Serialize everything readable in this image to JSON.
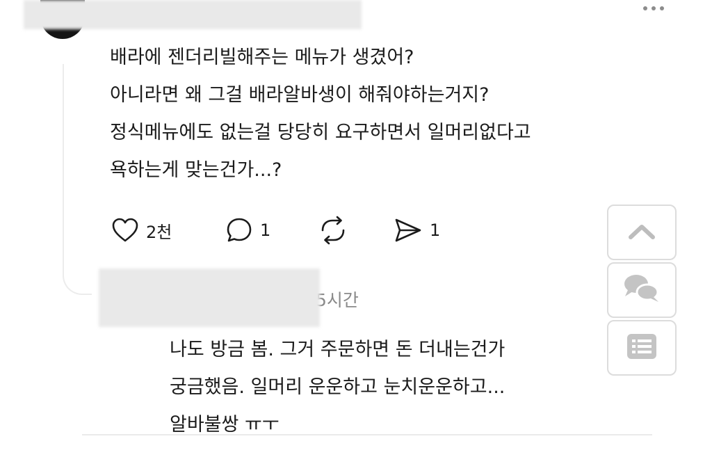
{
  "post": {
    "lines": [
      "배라에 젠더리빌해주는 메뉴가 생겼어?",
      "아니라면 왜 그걸 배라알바생이 해줘야하는거지?",
      "정식메뉴에도 없는걸 당당히 요구하면서 일머리없다고",
      "욕하는게 맞는건가...?"
    ],
    "actions": {
      "like_count": "2천",
      "comment_count": "1",
      "share_count": "1"
    }
  },
  "reply": {
    "time": "5시간",
    "lines": [
      "나도 방금 봄. 그거 주문하면 돈 더내는건가",
      "궁금했음. 일머리 운운하고 눈치운운하고...",
      "알바불쌍 ㅠㅜ"
    ]
  },
  "icons": {
    "more": "more-horizontal-icon",
    "like": "heart-icon",
    "comment": "comment-bubble-icon",
    "repost": "repost-icon",
    "share": "send-icon",
    "scroll_top": "chevron-up-icon",
    "comments": "chat-bubbles-icon",
    "list": "list-icon"
  },
  "colors": {
    "text": "#1b1b1b",
    "muted": "#8a8a8a",
    "border": "#dcdcdc",
    "icon_gray": "#cfcfcf"
  }
}
